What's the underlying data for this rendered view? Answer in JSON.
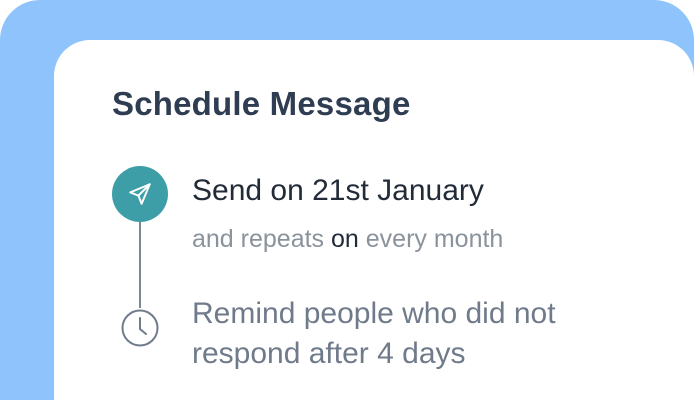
{
  "colors": {
    "backdrop": "#8fc3fb",
    "card": "#ffffff",
    "title": "#2f3d52",
    "accent": "#3e9ea8",
    "muted": "#8a929c",
    "body": "#222b38"
  },
  "schedule": {
    "title": "Schedule Message",
    "send_icon": "send-paper-plane-icon",
    "send_date": "Send on 21st January",
    "repeat": {
      "prefix": "and repeats",
      "joiner": "on",
      "suffix": "every month"
    },
    "clock_icon": "clock-icon",
    "reminder": "Remind people who did not respond after 4 days"
  }
}
